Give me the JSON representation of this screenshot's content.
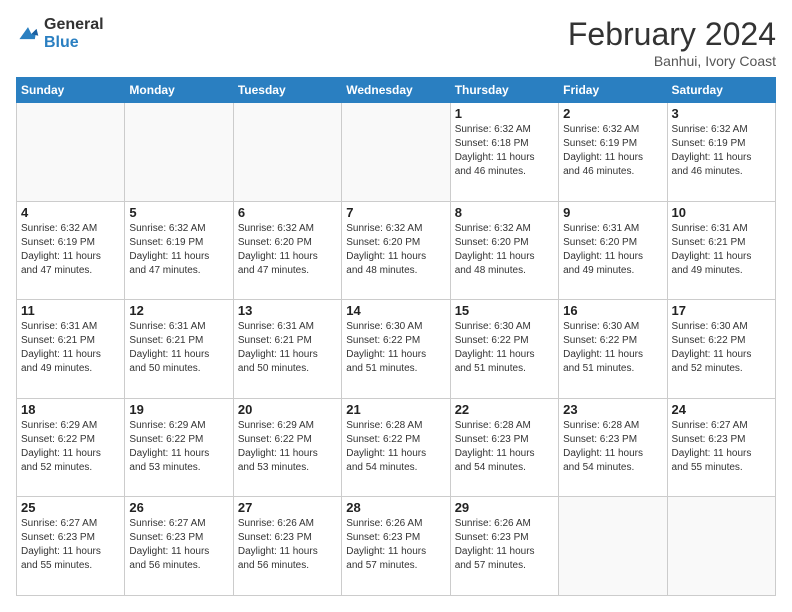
{
  "logo": {
    "line1": "General",
    "line2": "Blue"
  },
  "header": {
    "month_title": "February 2024",
    "subtitle": "Banhui, Ivory Coast"
  },
  "weekdays": [
    "Sunday",
    "Monday",
    "Tuesday",
    "Wednesday",
    "Thursday",
    "Friday",
    "Saturday"
  ],
  "weeks": [
    [
      {
        "day": "",
        "info": ""
      },
      {
        "day": "",
        "info": ""
      },
      {
        "day": "",
        "info": ""
      },
      {
        "day": "",
        "info": ""
      },
      {
        "day": "1",
        "info": "Sunrise: 6:32 AM\nSunset: 6:18 PM\nDaylight: 11 hours\nand 46 minutes."
      },
      {
        "day": "2",
        "info": "Sunrise: 6:32 AM\nSunset: 6:19 PM\nDaylight: 11 hours\nand 46 minutes."
      },
      {
        "day": "3",
        "info": "Sunrise: 6:32 AM\nSunset: 6:19 PM\nDaylight: 11 hours\nand 46 minutes."
      }
    ],
    [
      {
        "day": "4",
        "info": "Sunrise: 6:32 AM\nSunset: 6:19 PM\nDaylight: 11 hours\nand 47 minutes."
      },
      {
        "day": "5",
        "info": "Sunrise: 6:32 AM\nSunset: 6:19 PM\nDaylight: 11 hours\nand 47 minutes."
      },
      {
        "day": "6",
        "info": "Sunrise: 6:32 AM\nSunset: 6:20 PM\nDaylight: 11 hours\nand 47 minutes."
      },
      {
        "day": "7",
        "info": "Sunrise: 6:32 AM\nSunset: 6:20 PM\nDaylight: 11 hours\nand 48 minutes."
      },
      {
        "day": "8",
        "info": "Sunrise: 6:32 AM\nSunset: 6:20 PM\nDaylight: 11 hours\nand 48 minutes."
      },
      {
        "day": "9",
        "info": "Sunrise: 6:31 AM\nSunset: 6:20 PM\nDaylight: 11 hours\nand 49 minutes."
      },
      {
        "day": "10",
        "info": "Sunrise: 6:31 AM\nSunset: 6:21 PM\nDaylight: 11 hours\nand 49 minutes."
      }
    ],
    [
      {
        "day": "11",
        "info": "Sunrise: 6:31 AM\nSunset: 6:21 PM\nDaylight: 11 hours\nand 49 minutes."
      },
      {
        "day": "12",
        "info": "Sunrise: 6:31 AM\nSunset: 6:21 PM\nDaylight: 11 hours\nand 50 minutes."
      },
      {
        "day": "13",
        "info": "Sunrise: 6:31 AM\nSunset: 6:21 PM\nDaylight: 11 hours\nand 50 minutes."
      },
      {
        "day": "14",
        "info": "Sunrise: 6:30 AM\nSunset: 6:22 PM\nDaylight: 11 hours\nand 51 minutes."
      },
      {
        "day": "15",
        "info": "Sunrise: 6:30 AM\nSunset: 6:22 PM\nDaylight: 11 hours\nand 51 minutes."
      },
      {
        "day": "16",
        "info": "Sunrise: 6:30 AM\nSunset: 6:22 PM\nDaylight: 11 hours\nand 51 minutes."
      },
      {
        "day": "17",
        "info": "Sunrise: 6:30 AM\nSunset: 6:22 PM\nDaylight: 11 hours\nand 52 minutes."
      }
    ],
    [
      {
        "day": "18",
        "info": "Sunrise: 6:29 AM\nSunset: 6:22 PM\nDaylight: 11 hours\nand 52 minutes."
      },
      {
        "day": "19",
        "info": "Sunrise: 6:29 AM\nSunset: 6:22 PM\nDaylight: 11 hours\nand 53 minutes."
      },
      {
        "day": "20",
        "info": "Sunrise: 6:29 AM\nSunset: 6:22 PM\nDaylight: 11 hours\nand 53 minutes."
      },
      {
        "day": "21",
        "info": "Sunrise: 6:28 AM\nSunset: 6:22 PM\nDaylight: 11 hours\nand 54 minutes."
      },
      {
        "day": "22",
        "info": "Sunrise: 6:28 AM\nSunset: 6:23 PM\nDaylight: 11 hours\nand 54 minutes."
      },
      {
        "day": "23",
        "info": "Sunrise: 6:28 AM\nSunset: 6:23 PM\nDaylight: 11 hours\nand 54 minutes."
      },
      {
        "day": "24",
        "info": "Sunrise: 6:27 AM\nSunset: 6:23 PM\nDaylight: 11 hours\nand 55 minutes."
      }
    ],
    [
      {
        "day": "25",
        "info": "Sunrise: 6:27 AM\nSunset: 6:23 PM\nDaylight: 11 hours\nand 55 minutes."
      },
      {
        "day": "26",
        "info": "Sunrise: 6:27 AM\nSunset: 6:23 PM\nDaylight: 11 hours\nand 56 minutes."
      },
      {
        "day": "27",
        "info": "Sunrise: 6:26 AM\nSunset: 6:23 PM\nDaylight: 11 hours\nand 56 minutes."
      },
      {
        "day": "28",
        "info": "Sunrise: 6:26 AM\nSunset: 6:23 PM\nDaylight: 11 hours\nand 57 minutes."
      },
      {
        "day": "29",
        "info": "Sunrise: 6:26 AM\nSunset: 6:23 PM\nDaylight: 11 hours\nand 57 minutes."
      },
      {
        "day": "",
        "info": ""
      },
      {
        "day": "",
        "info": ""
      }
    ]
  ]
}
